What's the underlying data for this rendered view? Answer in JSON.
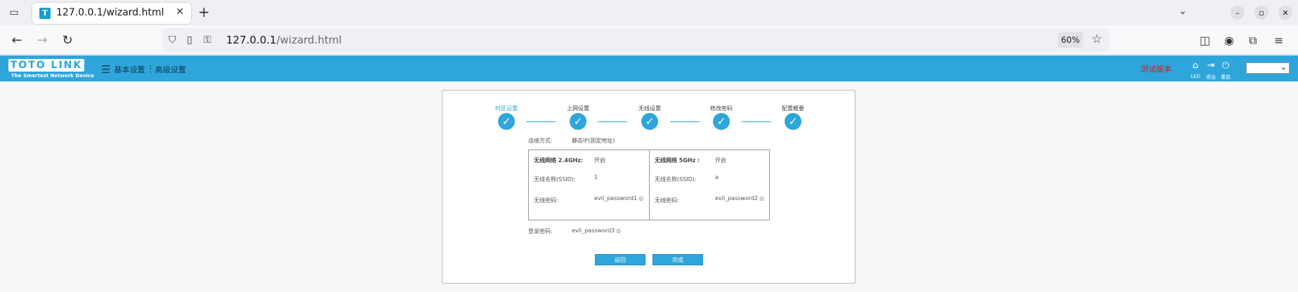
{
  "browser": {
    "tab_title": "127.0.0.1/wizard.html",
    "url_host": "127.0.0.1",
    "url_path": "/wizard.html",
    "zoom": "60%"
  },
  "header": {
    "logo_text": "TOTO LINK",
    "logo_sub": "The Smartest Network Device",
    "menu_basic": "基本设置",
    "menu_advanced": "高级设置",
    "test_version": "测试版本",
    "icon_led": "LED",
    "icon_logout": "退出",
    "icon_restart": "重启"
  },
  "wizard": {
    "steps": [
      "时区设置",
      "上网设置",
      "无线设置",
      "修改密码",
      "配置概要"
    ],
    "connection_label": "连接方式:",
    "connection_value": "静态IP(固定地址)",
    "wifi24": {
      "label": "无线网络 2.4GHz:",
      "status": "开启",
      "ssid_label": "无线名称(SSID):",
      "ssid": "1",
      "pwd_label": "无线密码:",
      "pwd": "evil_password1"
    },
    "wifi5": {
      "label": "无线网络 5GHz :",
      "status": "开启",
      "ssid_label": "无线名称(SSID):",
      "ssid": "a",
      "pwd_label": "无线密码:",
      "pwd": "evil_password2"
    },
    "login_pwd_label": "登录密码:",
    "login_pwd": "evil_password3",
    "back_button": "返回",
    "finish_button": "完成"
  }
}
